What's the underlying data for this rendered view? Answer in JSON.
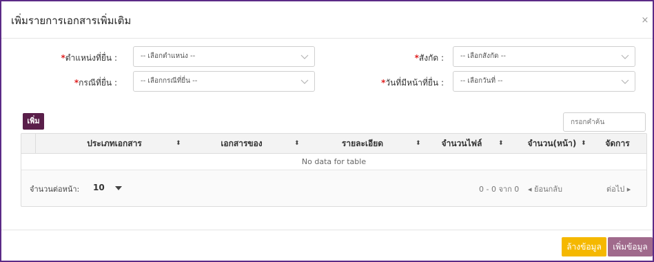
{
  "modal": {
    "title": "เพิ่มรายการเอกสารเพิ่มเติม",
    "close_symbol": "×"
  },
  "form": {
    "position": {
      "required_mark": "*",
      "label": "ตำแหน่งที่ยื่น :",
      "placeholder": "-- เลือกตำแหน่ง --"
    },
    "affiliation": {
      "required_mark": "*",
      "label": "สังกัด :",
      "placeholder": "-- เลือกสังกัด --"
    },
    "case": {
      "required_mark": "*",
      "label": "กรณีที่ยื่น :",
      "placeholder": "-- เลือกกรณีที่ยื่น --"
    },
    "duty_date": {
      "required_mark": "*",
      "label": "วันที่มีหน้าที่ยื่น :",
      "placeholder": "-- เลือกวันที่ --"
    }
  },
  "table": {
    "add_label": "เพิ่ม",
    "search_placeholder": "กรอกคำค้น",
    "columns": [
      "ประเภทเอกสาร",
      "เอกสารของ",
      "รายละเอียด",
      "จำนวนไฟล์",
      "จำนวน(หน้า)",
      "จัดการ"
    ],
    "sort_glyph": "⬍",
    "empty_text": "No data for table",
    "per_page_label": "จำนวนต่อหน้า:",
    "per_page_value": "10",
    "page_info": "0 - 0 จาก 0",
    "prev_label": "◂  ย้อนกลับ",
    "next_label": "ต่อไป  ▸"
  },
  "footer": {
    "clear_label": "ล้างข้อมูล",
    "submit_label": "เพิ่มข้อมูล"
  },
  "colors": {
    "border_accent": "#5b2a86",
    "add_button": "#5a1f4a",
    "clear_button": "#f5b800",
    "submit_button": "#a06a8c",
    "required": "#e02020"
  }
}
